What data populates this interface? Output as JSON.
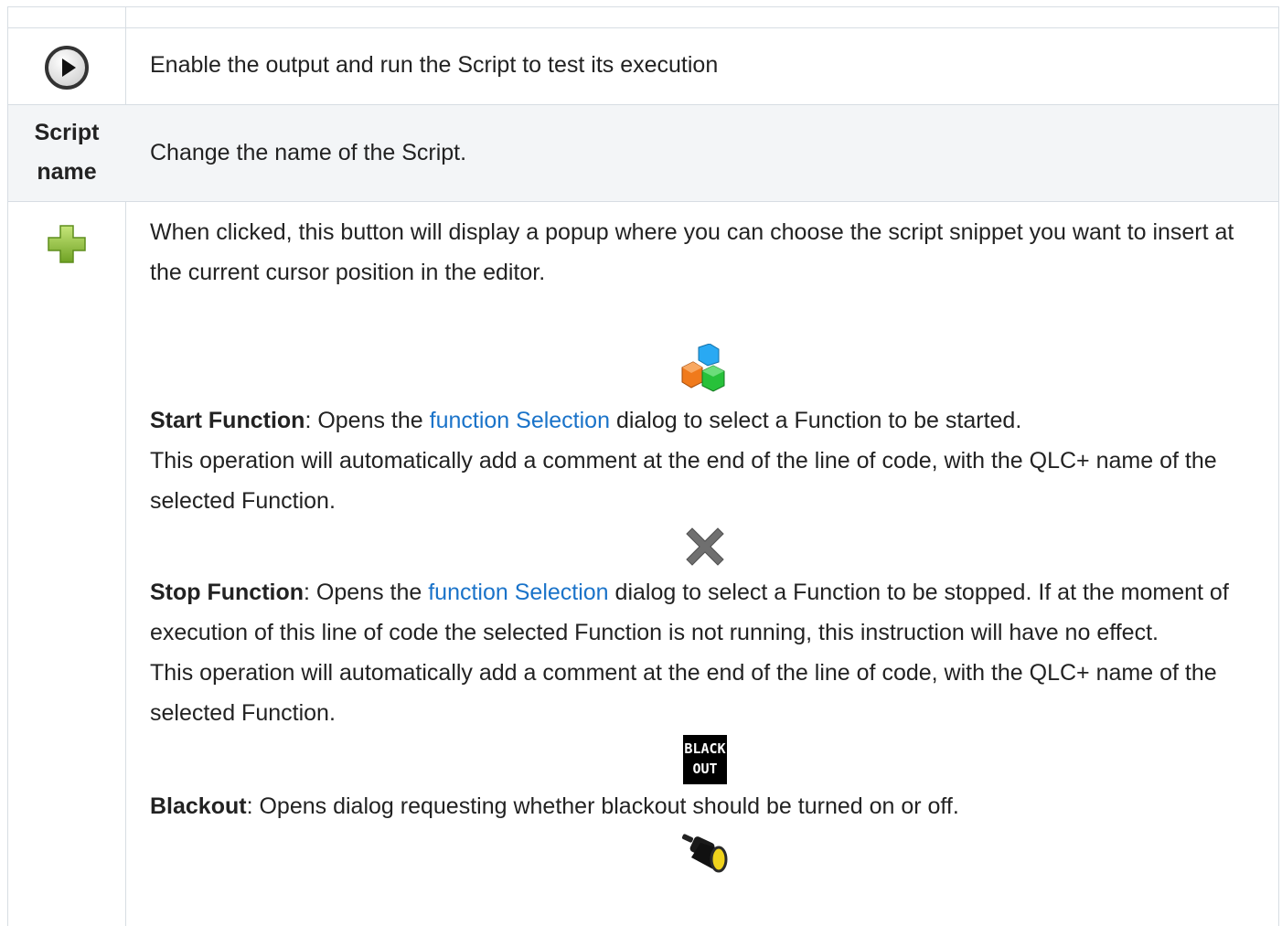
{
  "rows": {
    "play": {
      "icon": "play-button-icon",
      "text": "Enable the output and run the Script to test its execution"
    },
    "script_name": {
      "label_line1": "Script",
      "label_line2": "name",
      "text": "Change the name of the Script."
    },
    "add": {
      "icon": "green-plus-icon",
      "intro": "When clicked, this button will display a popup where you can choose the script snippet you want to insert at the current cursor position in the editor.",
      "start_function": {
        "icon": "function-cubes-icon",
        "title": "Start Function",
        "text_before_link": ": Opens the ",
        "link": "function Selection",
        "text_after_link": " dialog to select a Function to be started.",
        "note": "This operation will automatically add a comment at the end of the line of code, with the QLC+ name of the selected Function."
      },
      "stop_function": {
        "icon": "gray-x-icon",
        "title": "Stop Function",
        "text_before_link": ": Opens the ",
        "link": "function Selection",
        "text_after_link": " dialog to select a Function to be stopped. If at the moment of execution of this line of code the selected Function is not running, this instruction will have no effect.",
        "note": "This operation will automatically add a comment at the end of the line of code, with the QLC+ name of the selected Function."
      },
      "blackout": {
        "icon": "blackout-icon",
        "icon_text_line1": "BLACK",
        "icon_text_line2": "OUT",
        "title": "Blackout",
        "text": ": Opens dialog requesting whether blackout should be turned on or off."
      },
      "next_icon": "spotlight-icon"
    }
  }
}
